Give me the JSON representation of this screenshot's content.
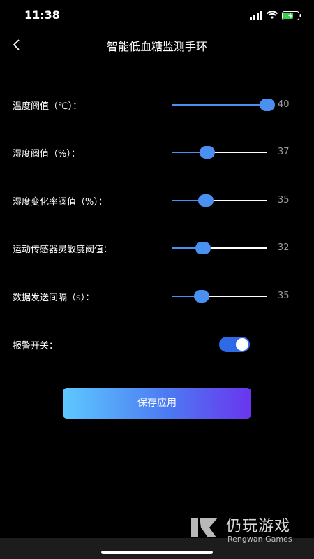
{
  "status_bar": {
    "time": "11:38"
  },
  "header": {
    "title": "智能低血糖监测手环"
  },
  "settings": [
    {
      "label": "温度阀值（℃）：",
      "value": "40",
      "level": 1.0
    },
    {
      "label": "湿度阀值（%）：",
      "value": "37",
      "level": 0.37
    },
    {
      "label": "湿度变化率阀值（%）：",
      "value": "35",
      "level": 0.35
    },
    {
      "label": "运动传感器灵敏度阀值：",
      "value": "32",
      "level": 0.32
    },
    {
      "label": "数据发送间隔（s）：",
      "value": "35",
      "level": 0.31
    }
  ],
  "alarm": {
    "label": "报警开关：",
    "enabled": true
  },
  "save_button": {
    "label": "保存应用"
  },
  "watermark": {
    "brand_cn": "仍玩游戏",
    "brand_en": "Rengwan Games"
  },
  "colors": {
    "accent": "#4a90f0",
    "toggle_on": "#2f6ae6",
    "value_text": "#9a9a9a"
  }
}
